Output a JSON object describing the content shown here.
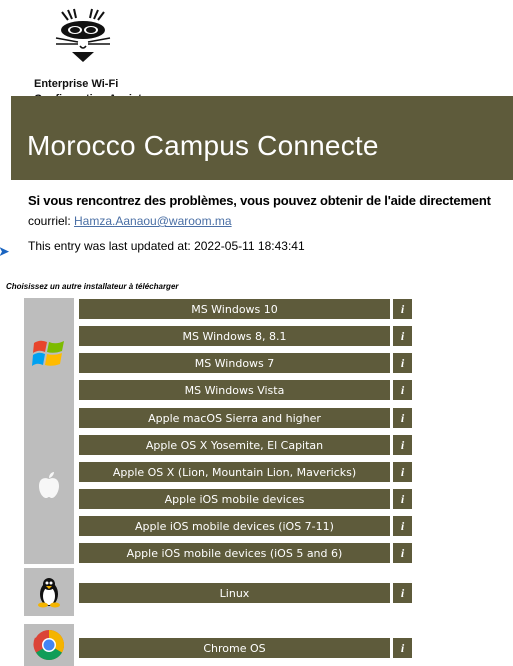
{
  "logo": {
    "text": "Enterprise Wi-Fi",
    "subtext": "Configuration Assistant Tool"
  },
  "banner": {
    "title": "Morocco Campus Connecte"
  },
  "help": {
    "text": "Si vous rencontrez des problèmes, vous pouvez obtenir de l'aide directement",
    "email_prefix": "courriel: ",
    "email": "Hamza.Aanaou@waroom.ma"
  },
  "updated": "This entry was last updated at: 2022-05-11 18:43:41",
  "choose_label": "Choisissez un autre installateur à télécharger",
  "info_label": "i",
  "groups": {
    "windows": {
      "icon": "windows-logo-icon",
      "items": [
        "MS Windows 10",
        "MS Windows 8, 8.1",
        "MS Windows 7",
        "MS Windows Vista"
      ]
    },
    "apple": {
      "icon": "apple-logo-icon",
      "items": [
        "Apple macOS Sierra and higher",
        "Apple OS X Yosemite, El Capitan",
        "Apple OS X (Lion, Mountain Lion, Mavericks)",
        "Apple iOS mobile devices",
        "Apple iOS mobile devices (iOS 7-11)",
        "Apple iOS mobile devices (iOS 5 and 6)"
      ]
    },
    "linux": {
      "icon": "linux-penguin-icon",
      "items": [
        "Linux"
      ]
    },
    "chrome": {
      "icon": "chrome-logo-icon",
      "items": [
        "Chrome OS"
      ]
    }
  },
  "colors": {
    "brand": "#5e5b3b",
    "icon_bg": "#bdbdbd",
    "link": "#4a6fa5"
  }
}
